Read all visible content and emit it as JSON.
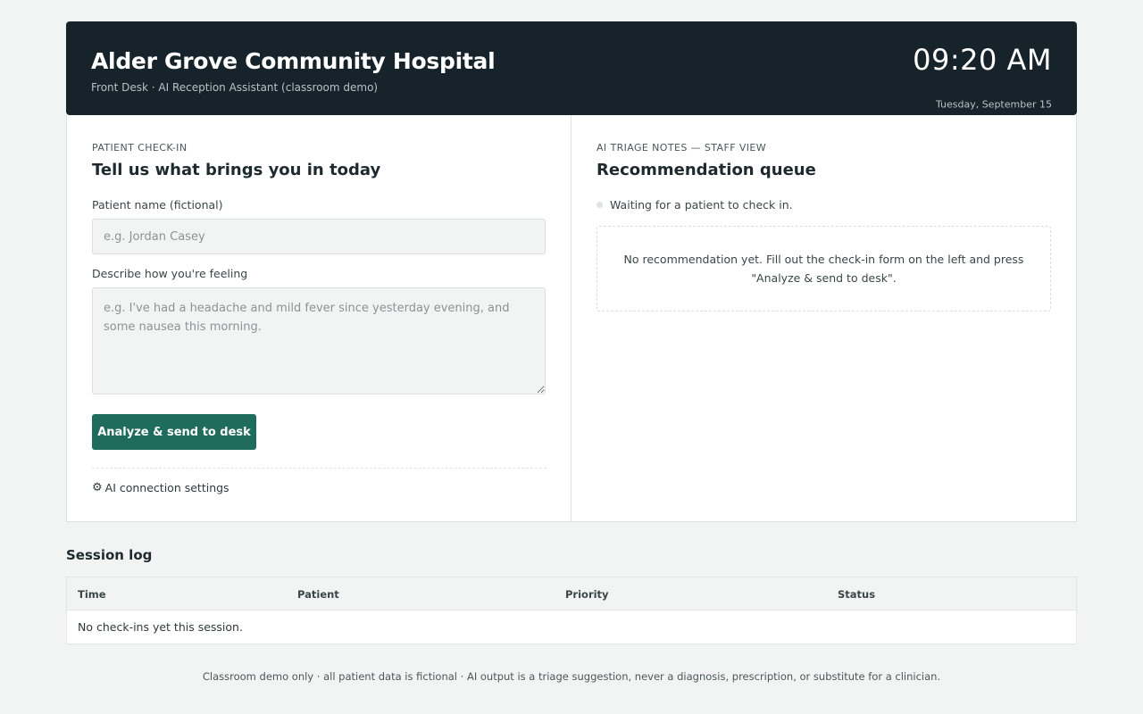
{
  "header": {
    "title": "Alder Grove Community Hospital",
    "subtitle": "Front Desk · AI Reception Assistant (classroom demo)",
    "time": "09:20 AM",
    "date": "Tuesday, September 15"
  },
  "checkin": {
    "eyebrow": "Patient check-in",
    "heading": "Tell us what brings you in today",
    "name_label": "Patient name (fictional)",
    "name_value": "",
    "name_placeholder": "e.g. Jordan Casey",
    "feeling_label": "Describe how you're feeling",
    "feeling_value": "",
    "feeling_placeholder": "e.g. I've had a headache and mild fever since yesterday evening, and some nausea this morning.",
    "submit_label": "Analyze & send to desk",
    "settings_label": "AI connection settings"
  },
  "triage": {
    "eyebrow": "AI triage notes — staff view",
    "heading": "Recommendation queue",
    "status_text": "Waiting for a patient to check in.",
    "empty_text": "No recommendation yet. Fill out the check-in form on the left and press \"Analyze & send to desk\"."
  },
  "session_log": {
    "title": "Session log",
    "columns": [
      "Time",
      "Patient",
      "Priority",
      "Status"
    ],
    "empty_text": "No check-ins yet this session."
  },
  "footer": {
    "text": "Classroom demo only · all patient data is fictional · AI output is a triage suggestion, never a diagnosis, prescription, or substitute for a clinician."
  },
  "icons": {
    "settings": "gear-icon",
    "status": "status-dot-icon"
  },
  "colors": {
    "header_bg": "#17232a",
    "primary": "#1f6b5c",
    "page_bg": "#f2f4f3"
  }
}
